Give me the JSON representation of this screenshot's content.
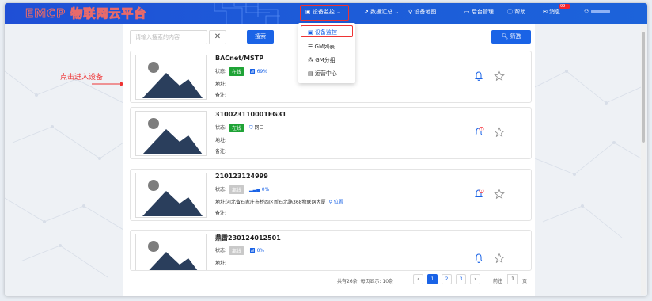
{
  "app": {
    "logo": "EMCP 物联网云平台"
  },
  "nav": {
    "items": [
      {
        "label": "设备监控"
      },
      {
        "label": "数据汇总"
      },
      {
        "label": "设备地图"
      },
      {
        "label": "后台管理"
      },
      {
        "label": "帮助"
      },
      {
        "label": "消息"
      }
    ],
    "badge": "99+",
    "dropdown": [
      "设备监控",
      "GM列表",
      "GM分组",
      "运营中心"
    ]
  },
  "toolbar": {
    "search_placeholder": "请输入搜索的内容",
    "clear": "✕",
    "search": "搜索",
    "filter": "筛选"
  },
  "annotation": "点击进入设备",
  "labels": {
    "status": "状态:",
    "address": "地址:",
    "remark": "备注:"
  },
  "devices": [
    {
      "name": "BACnet/MSTP",
      "status": "在线",
      "signal": "69%",
      "address": "",
      "remark": ""
    },
    {
      "name": "310023110001EG31",
      "status": "在线",
      "network": "网口",
      "address": "",
      "remark": ""
    },
    {
      "name": "210123124999",
      "status": "离线",
      "signal": "0%",
      "address": "河北省石家庄市桥西区新石北路368物联网大厦",
      "location": "位置",
      "remark": ""
    },
    {
      "name": "鼎雷230124012501",
      "status": "离线",
      "signal": "0%",
      "address": "",
      "remark": ""
    }
  ],
  "pagination": {
    "summary": "共有26条, 每页显示: 10条",
    "pages": [
      "1",
      "2",
      "3"
    ],
    "goto_label": "前往",
    "goto_value": "1",
    "page_unit": "页"
  },
  "colors": {
    "primary": "#1a63e6",
    "online": "#1fa336",
    "offline": "#c9c9c9",
    "highlight": "#e33"
  }
}
